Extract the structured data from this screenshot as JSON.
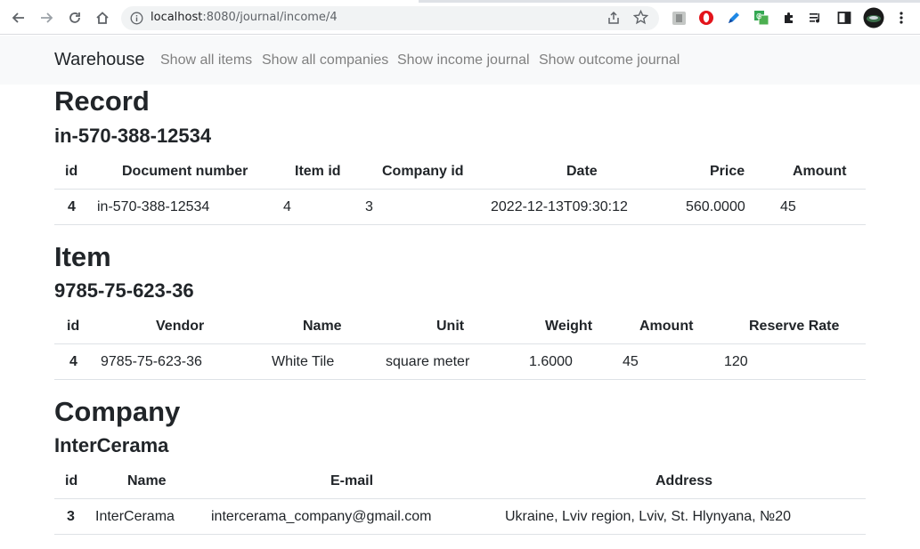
{
  "browser": {
    "url_host": "localhost",
    "url_rest": ":8080/journal/income/4"
  },
  "navbar": {
    "brand": "Warehouse",
    "links": [
      "Show all items",
      "Show all companies",
      "Show income journal",
      "Show outcome journal"
    ]
  },
  "record": {
    "title": "Record",
    "subtitle": "in-570-388-12534",
    "columns": [
      "id",
      "Document number",
      "Item id",
      "Company id",
      "Date",
      "Price",
      "Amount"
    ],
    "rows": [
      [
        "4",
        "in-570-388-12534",
        "4",
        "3",
        "2022-12-13T09:30:12",
        "560.0000",
        "45"
      ]
    ]
  },
  "item": {
    "title": "Item",
    "subtitle": "9785-75-623-36",
    "columns": [
      "id",
      "Vendor",
      "Name",
      "Unit",
      "Weight",
      "Amount",
      "Reserve Rate"
    ],
    "rows": [
      [
        "4",
        "9785-75-623-36",
        "White Tile",
        "square meter",
        "1.6000",
        "45",
        "120"
      ]
    ]
  },
  "company": {
    "title": "Company",
    "subtitle": "InterCerama",
    "columns": [
      "id",
      "Name",
      "E-mail",
      "Address"
    ],
    "rows": [
      [
        "3",
        "InterCerama",
        "intercerama_company@gmail.com",
        "Ukraine, Lviv region, Lviv, St. Hlynyana, №20"
      ]
    ]
  }
}
